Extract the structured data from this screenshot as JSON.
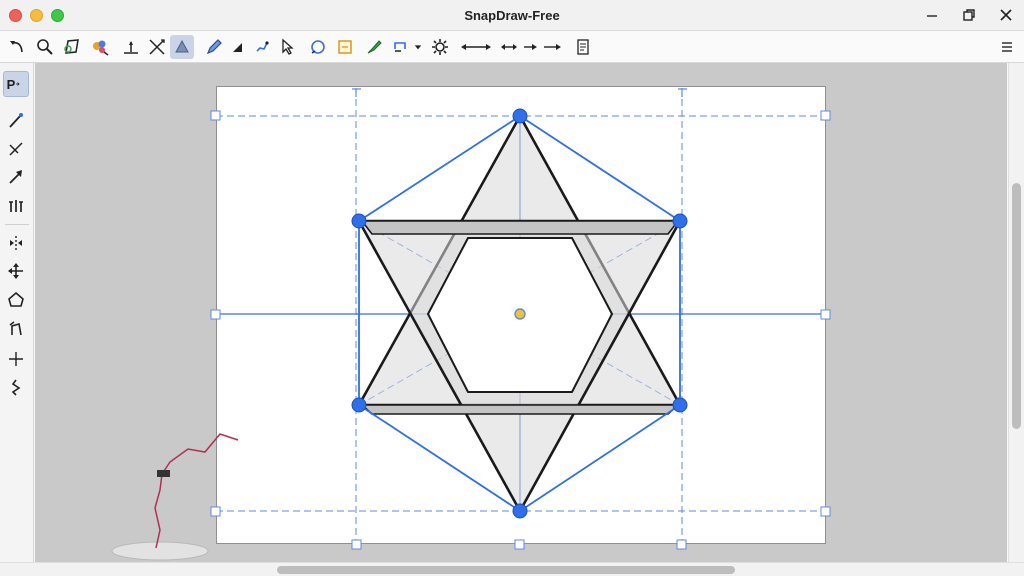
{
  "window": {
    "title": "SnapDraw-Free"
  },
  "toolbar": {
    "icons": [
      "undo-icon",
      "zoom-icon",
      "lasso-icon",
      "color-palette-icon",
      "point-on-line-icon",
      "intersect-icon",
      "fill-tool-icon",
      "pen-icon",
      "triangle-icon",
      "segment-icon",
      "cursor-icon",
      "circle-icon",
      "rectangle-icon",
      "brush-icon",
      "line-style-icon",
      "settings-icon",
      "double-arrow-icon",
      "dotted-arrow-icon",
      "arrow-icon",
      "long-arrow-icon",
      "document-icon",
      "menu-icon"
    ]
  },
  "palette": {
    "point_tool_label": "P",
    "icons": [
      "point-tool-icon",
      "line-tool-icon",
      "perpendicular-tool-icon",
      "vector-tool-icon",
      "parallel-tool-icon",
      "reflect-tool-icon",
      "move-tool-icon",
      "polygon-tool-icon",
      "rotate-tool-icon",
      "axis-tool-icon",
      "measure-tool-icon"
    ]
  },
  "colors": {
    "accent": "#2f6fe8",
    "selection": "#3a6fd8",
    "guide": "#5b8be0",
    "shape_stroke": "#1a1a1a",
    "shape_fill": "#dcdcdc",
    "stray_line": "#b03050",
    "center_point": "#f2c232"
  }
}
